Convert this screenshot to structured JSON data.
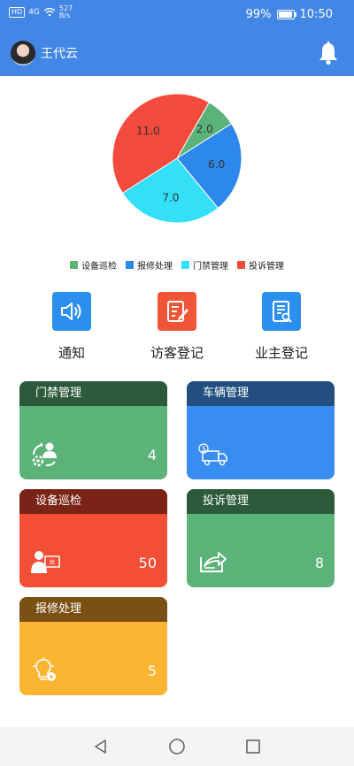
{
  "status": {
    "network_tag": "HD",
    "signal": "4G",
    "speed_value": "527",
    "speed_unit": "B/s",
    "battery": "99%",
    "battery_level": 0.99,
    "time": "10:50"
  },
  "user": {
    "name": "王代云"
  },
  "icons": {
    "bell": "bell-icon",
    "notice": "speaker-icon",
    "visitor": "edit-form-icon",
    "owner": "document-search-icon"
  },
  "chart_data": {
    "type": "pie",
    "series": [
      {
        "name": "设备巡检",
        "value": 2.0,
        "label": "2.0",
        "color": "#5cb37a"
      },
      {
        "name": "报修处理",
        "value": 6.0,
        "label": "6.0",
        "color": "#2d88eb"
      },
      {
        "name": "门禁管理",
        "value": 7.0,
        "label": "7.0",
        "color": "#33e0f7"
      },
      {
        "name": "投诉管理",
        "value": 11.0,
        "label": "11.0",
        "color": "#f24a3c"
      }
    ],
    "legend_position": "bottom"
  },
  "actions": [
    {
      "label": "通知",
      "color": "#2b8fef"
    },
    {
      "label": "访客登记",
      "color": "#f05537"
    },
    {
      "label": "业主登记",
      "color": "#2b8fef"
    }
  ],
  "cards": [
    {
      "title": "门禁管理",
      "count": "4",
      "top_color": "#2d5a3a",
      "body_color": "#5cb37a",
      "icon": "access-users-icon"
    },
    {
      "title": "车辆管理",
      "count": "",
      "top_color": "#224f80",
      "body_color": "#3a8df0",
      "icon": "truck-icon"
    },
    {
      "title": "设备巡检",
      "count": "50",
      "top_color": "#7a2418",
      "body_color": "#f24f36",
      "icon": "inspector-icon"
    },
    {
      "title": "投诉管理",
      "count": "8",
      "top_color": "#2d5a3a",
      "body_color": "#5cb37a",
      "icon": "share-box-icon"
    },
    {
      "title": "报修处理",
      "count": "5",
      "top_color": "#7a5014",
      "body_color": "#fbb531",
      "icon": "bulb-gear-icon"
    }
  ]
}
